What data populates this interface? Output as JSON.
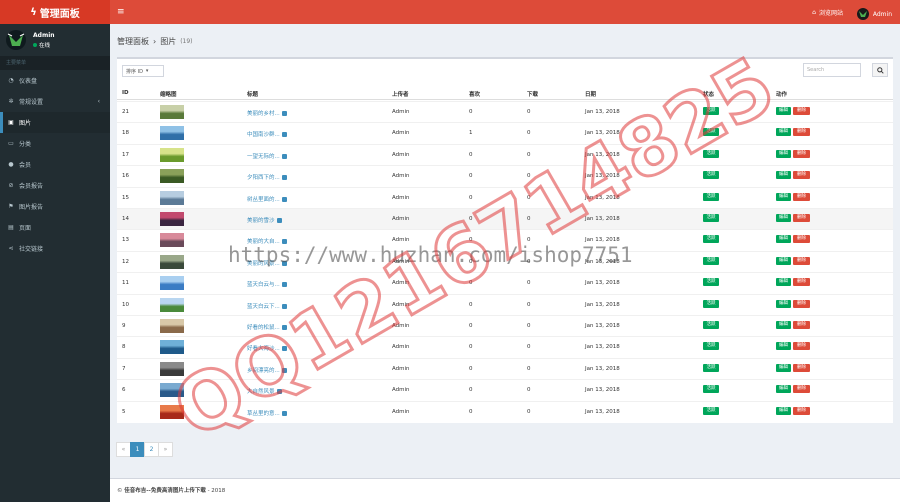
{
  "brand": {
    "title": "管理面板"
  },
  "topbar": {
    "visit_label": "浏览网站",
    "user_name": "Admin"
  },
  "sidebar": {
    "user_name": "Admin",
    "user_status": "在线",
    "header": "主要菜单",
    "items": [
      {
        "label": "仪表盘",
        "icon": "dashboard-icon"
      },
      {
        "label": "常规设置",
        "icon": "cogs-icon",
        "chevron": "‹"
      },
      {
        "label": "图片",
        "icon": "image-icon",
        "active": true
      },
      {
        "label": "分类",
        "icon": "folder-icon"
      },
      {
        "label": "会员",
        "icon": "user-icon"
      },
      {
        "label": "会员报告",
        "icon": "ban-icon"
      },
      {
        "label": "图片报告",
        "icon": "flag-icon"
      },
      {
        "label": "页面",
        "icon": "page-icon"
      },
      {
        "label": "社交链接",
        "icon": "share-icon"
      }
    ]
  },
  "breadcrumb": {
    "root": "管理面板",
    "current": "图片",
    "count": "(19)"
  },
  "toolbar": {
    "sort_label": "排序 ID",
    "search_placeholder": "Search"
  },
  "table": {
    "headers": {
      "id": "ID",
      "thumb": "缩略图",
      "title": "标题",
      "uploader": "上传者",
      "likes": "喜欢",
      "downloads": "下载",
      "date": "日期",
      "status": "状态",
      "actions": "动作"
    },
    "status_label": "活跃",
    "edit_label": "编辑",
    "delete_label": "删除",
    "rows": [
      {
        "id": "21",
        "title": "美丽的乡村...",
        "uploader": "Admin",
        "likes": "0",
        "downloads": "0",
        "date": "Jan 13, 2018",
        "thumb": [
          "#5a7a3a",
          "#c8d0a8"
        ]
      },
      {
        "id": "18",
        "title": "中国南沙群...",
        "uploader": "Admin",
        "likes": "1",
        "downloads": "0",
        "date": "Jan 13, 2018",
        "thumb": [
          "#2f6fa8",
          "#8fc1e6"
        ]
      },
      {
        "id": "17",
        "title": "一望无际的...",
        "uploader": "Admin",
        "likes": "0",
        "downloads": "0",
        "date": "Jan 13, 2018",
        "thumb": [
          "#6a9a2c",
          "#d7e38a"
        ]
      },
      {
        "id": "16",
        "title": "夕阳西下的...",
        "uploader": "Admin",
        "likes": "0",
        "downloads": "0",
        "date": "Jan 13, 2018",
        "thumb": [
          "#3a5a24",
          "#8aa15a"
        ]
      },
      {
        "id": "15",
        "title": "树丛里面的...",
        "uploader": "Admin",
        "likes": "0",
        "downloads": "0",
        "date": "Jan 13, 2018",
        "thumb": [
          "#5b7a96",
          "#b7cde0"
        ]
      },
      {
        "id": "14",
        "title": "美丽的雪沙",
        "uploader": "Admin",
        "likes": "0",
        "downloads": "0",
        "date": "Jan 13, 2018",
        "thumb": [
          "#3a2540",
          "#c24a6e"
        ]
      },
      {
        "id": "13",
        "title": "美丽的大自...",
        "uploader": "Admin",
        "likes": "0",
        "downloads": "0",
        "date": "Jan 13, 2018",
        "thumb": [
          "#6a4a5a",
          "#d88a9a"
        ]
      },
      {
        "id": "12",
        "title": "美丽的风景...",
        "uploader": "Admin",
        "likes": "0",
        "downloads": "0",
        "date": "Jan 13, 2018",
        "thumb": [
          "#3a4a3a",
          "#9aa88a"
        ]
      },
      {
        "id": "11",
        "title": "蓝天白云与...",
        "uploader": "Admin",
        "likes": "0",
        "downloads": "0",
        "date": "Jan 13, 2018",
        "thumb": [
          "#3b7cc4",
          "#a9cff0"
        ]
      },
      {
        "id": "10",
        "title": "蓝天白云下...",
        "uploader": "Admin",
        "likes": "0",
        "downloads": "0",
        "date": "Jan 13, 2018",
        "thumb": [
          "#4a8a3a",
          "#b9d6f0"
        ]
      },
      {
        "id": "9",
        "title": "好看的松鼠...",
        "uploader": "Admin",
        "likes": "0",
        "downloads": "0",
        "date": "Jan 13, 2018",
        "thumb": [
          "#8a6a4a",
          "#d8c8a8"
        ]
      },
      {
        "id": "8",
        "title": "好看大海沙...",
        "uploader": "Admin",
        "likes": "0",
        "downloads": "0",
        "date": "Jan 13, 2018",
        "thumb": [
          "#1f5a8a",
          "#6fb0d8"
        ]
      },
      {
        "id": "7",
        "title": "乡间漂亮的...",
        "uploader": "Admin",
        "likes": "0",
        "downloads": "0",
        "date": "Jan 13, 2018",
        "thumb": [
          "#3a3a3a",
          "#8a8a8a"
        ]
      },
      {
        "id": "6",
        "title": "大自然风景",
        "uploader": "Admin",
        "likes": "0",
        "downloads": "0",
        "date": "Jan 13, 2018",
        "thumb": [
          "#2a5a8a",
          "#7aaad0"
        ]
      },
      {
        "id": "5",
        "title": "草丛里的意...",
        "uploader": "Admin",
        "likes": "0",
        "downloads": "0",
        "date": "Jan 13, 2018",
        "thumb": [
          "#a82a1a",
          "#e87a4a"
        ]
      }
    ]
  },
  "pagination": {
    "prev": "«",
    "pages": [
      "1",
      "2"
    ],
    "current": "1",
    "next": "»"
  },
  "footer": {
    "prefix": "©",
    "site": "佳音布吉--免费高清图片上传下载",
    "year": "- 2018"
  },
  "watermark": {
    "url": "https://www.huzhan.com/ishop7751",
    "qq": "QQ1216714825"
  },
  "colors": {
    "topbar": "#dd4b39",
    "sidebar": "#222d32",
    "accent": "#3c8dbc",
    "success": "#00a65a",
    "danger": "#dd4b39"
  }
}
